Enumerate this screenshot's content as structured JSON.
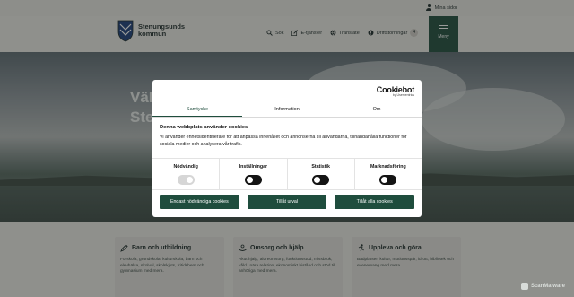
{
  "util": {
    "my_pages": "Mina sidor"
  },
  "header": {
    "logo_line1": "Stenungsunds",
    "logo_line2": "kommun",
    "nav": [
      {
        "label": "Sök",
        "icon": "search-icon"
      },
      {
        "label": "E-tjänster",
        "icon": "edit-icon"
      },
      {
        "label": "Translate",
        "icon": "globe-icon"
      },
      {
        "label": "Driftstörningar",
        "icon": "alert-icon",
        "count": "4"
      }
    ],
    "menu_label": "Meny"
  },
  "hero": {
    "title_line1": "Välk",
    "title_line2": "Sten"
  },
  "cards": [
    {
      "title": "Barn och utbildning",
      "icon": "pencil-icon",
      "text": "Förskola, grundskola, kulturskola, barn och elevhälsa, skolval, skolskjuts, fritidshem och gymnasium med mera."
    },
    {
      "title": "Omsorg och hjälp",
      "icon": "hands-icon",
      "text": "Akut hjälp, äldreomsorg, funktionsstöd, missbruk, våld i nära relation, ekonomiskt bistånd och stöd till anhöriga med mera."
    },
    {
      "title": "Uppleva och göra",
      "icon": "running-icon",
      "text": "Badplatser, kultur, motionsspår, idrott, bibliotek och evenemang med mera."
    }
  ],
  "dialog": {
    "brand": "Cookiebot",
    "brand_sub": "by Usercentrics",
    "tabs": [
      "Samtycke",
      "Information",
      "Om"
    ],
    "active_tab": "Samtycke",
    "heading": "Denna webbplats använder cookies",
    "text": "Vi använder enhetsidentifierare för att anpassa innehållet och annonserna till användarna, tillhandahålla funktioner för sociala medier och analysera vår trafik.",
    "toggles": [
      {
        "label": "Nödvändig",
        "on": true,
        "disabled": true
      },
      {
        "label": "Inställningar",
        "on": false,
        "disabled": false
      },
      {
        "label": "Statistik",
        "on": false,
        "disabled": false
      },
      {
        "label": "Marknadsföring",
        "on": false,
        "disabled": false
      }
    ],
    "buttons": [
      "Endast nödvändiga cookies",
      "Tillåt urval",
      "Tillåt alla cookies"
    ]
  },
  "watermark": "ScanMalware",
  "colors": {
    "brand_green": "#1f4d3d",
    "overlay": "rgba(30,33,31,0.45)"
  }
}
